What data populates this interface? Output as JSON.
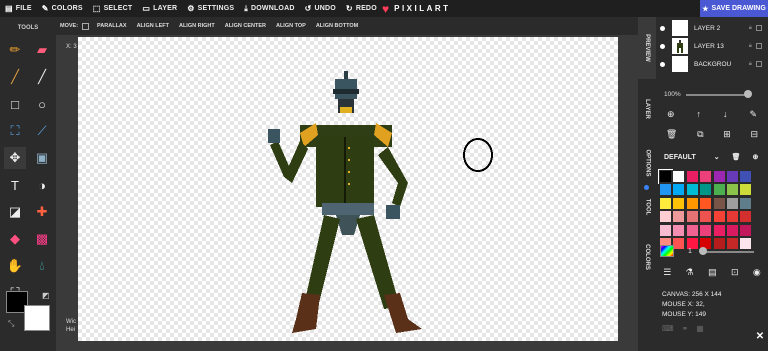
{
  "menu": {
    "file": "FILE",
    "colors": "COLORS",
    "select": "SELECT",
    "layer": "LAYER",
    "settings": "SETTINGS",
    "download": "DOWNLOAD",
    "undo": "UNDO",
    "redo": "REDO"
  },
  "brand": {
    "name": "PIXILART",
    "color": "#ff3d5a"
  },
  "save_label": "SAVE DRAWING",
  "tools": {
    "title": "TOOLS",
    "icons": [
      "pencil-icon",
      "eraser-icon",
      "brush-icon",
      "line-icon",
      "rectangle-icon",
      "ellipse-icon",
      "bucket-icon",
      "eyedropper-icon",
      "move-icon",
      "shade-icon",
      "text-icon",
      "dither-icon",
      "lighten-icon",
      "pattern-icon",
      "stamp-icon",
      "gradient-icon",
      "hand-icon",
      "drop-icon",
      "crop-icon"
    ]
  },
  "options": {
    "move_label": "MOVE:",
    "parallax": "PARALLAX",
    "align_left": "ALIGN LEFT",
    "align_right": "ALIGN RIGHT",
    "align_center": "ALIGN CENTER",
    "align_top": "ALIGN TOP",
    "align_bottom": "ALIGN BOTTOM"
  },
  "canvas_info": {
    "coord_prefix": "X: 3",
    "dims_line1": "Wic",
    "dims_line2": "Hei"
  },
  "side_tabs": {
    "preview": "PREVIEW",
    "layer": "LAYER",
    "options": "OPTIONS",
    "tool": "TOOL",
    "colors": "COLORS"
  },
  "layers": [
    {
      "name": "LAYER 2"
    },
    {
      "name": "LAYER 13"
    },
    {
      "name": "BACKGROU"
    }
  ],
  "opacity": "100%",
  "opacity_value": 1.0,
  "palette_name": "DEFAULT",
  "palette": [
    "#000000",
    "#ffffff",
    "#e91e63",
    "#ec407a",
    "#9c27b0",
    "#673ab7",
    "#3f51b5",
    "#2196f3",
    "#03a9f4",
    "#00bcd4",
    "#009688",
    "#4caf50",
    "#8bc34a",
    "#cddc39",
    "#ffeb3b",
    "#ffc107",
    "#ff9800",
    "#ff5722",
    "#795548",
    "#9e9e9e",
    "#607d8b",
    "#ffcdd2",
    "#ef9a9a",
    "#e57373",
    "#ef5350",
    "#f44336",
    "#e53935",
    "#d32f2f",
    "#f8bbd0",
    "#f48fb1",
    "#f06292",
    "#ec407a",
    "#e91e63",
    "#d81b60",
    "#c2185b",
    "#ff8a80",
    "#ff5252",
    "#ff1744",
    "#d50000",
    "#b71c1c",
    "#c62828",
    "#fce4ec"
  ],
  "brush_size": "1",
  "brush_size_value": 0.05,
  "info": {
    "canvas": "CANVAS: 256 X 144",
    "mouse_x": "MOUSE X: 32,",
    "mouse_y": "MOUSE Y: 149"
  },
  "accent": "#4a58d4"
}
